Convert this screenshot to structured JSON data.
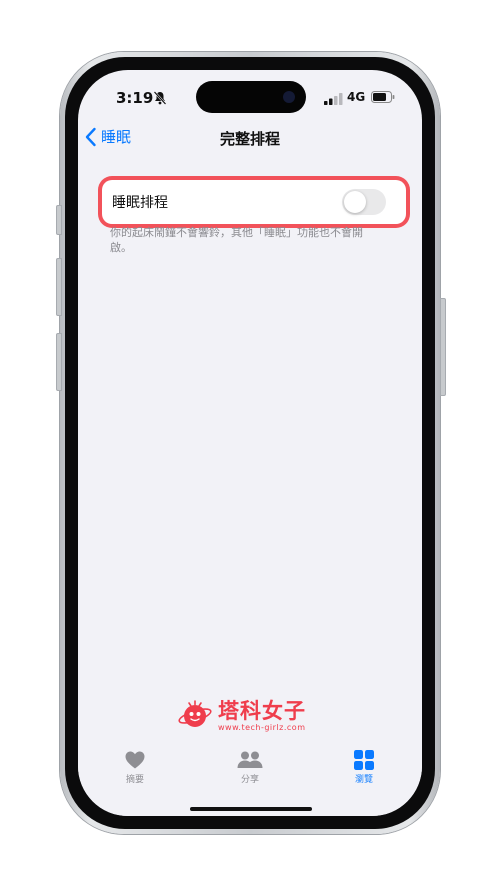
{
  "status_bar": {
    "time": "3:19",
    "network": "4G",
    "icons": [
      "mute-bell-icon",
      "signal-icon",
      "battery-icon"
    ]
  },
  "nav": {
    "back_label": "睡眠",
    "title": "完整排程"
  },
  "settings": {
    "schedule_row": {
      "label": "睡眠排程",
      "toggle_on": false
    },
    "footnote": "你的起床鬧鐘不會響鈴，其他「睡眠」功能也不會開啟。"
  },
  "watermark": {
    "text": "塔科女子",
    "url": "www.tech-girlz.com"
  },
  "tabbar": {
    "tabs": [
      {
        "label": "摘要",
        "icon": "heart-icon",
        "active": false
      },
      {
        "label": "分享",
        "icon": "people-icon",
        "active": false
      },
      {
        "label": "瀏覽",
        "icon": "grid-icon",
        "active": true
      }
    ]
  },
  "colors": {
    "accent": "#0a7aff",
    "highlight_border": "#f2525a",
    "background": "#f2f2f7",
    "watermark": "#ef3d4c"
  }
}
